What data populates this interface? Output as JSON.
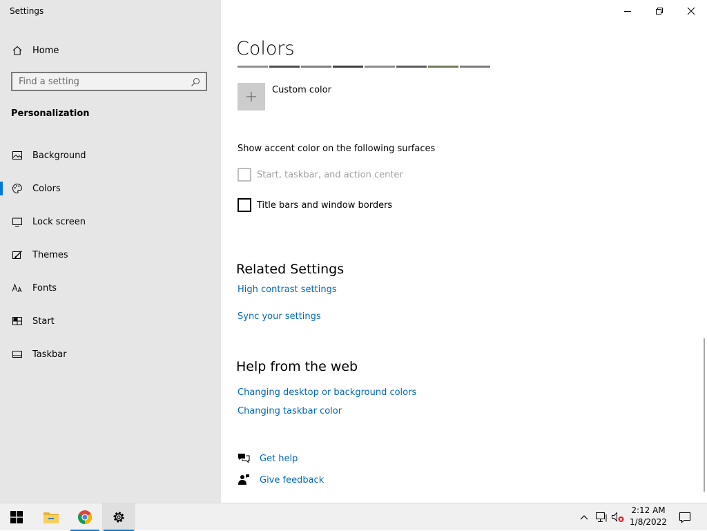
{
  "window": {
    "title": "Settings",
    "controls": {
      "minimize": "minimize",
      "restore": "restore",
      "close": "close"
    }
  },
  "sidebar": {
    "home_label": "Home",
    "search_placeholder": "Find a setting",
    "section_heading": "Personalization",
    "items": [
      {
        "label": "Background",
        "icon": "picture-icon"
      },
      {
        "label": "Colors",
        "icon": "palette-icon",
        "active": true
      },
      {
        "label": "Lock screen",
        "icon": "lock-screen-icon"
      },
      {
        "label": "Themes",
        "icon": "brush-icon"
      },
      {
        "label": "Fonts",
        "icon": "font-icon"
      },
      {
        "label": "Start",
        "icon": "start-icon"
      },
      {
        "label": "Taskbar",
        "icon": "taskbar-icon"
      }
    ]
  },
  "main": {
    "title": "Colors",
    "swatch_colors": [
      "#8f8f8f",
      "#4a4a4a",
      "#7e7e7e",
      "#3f3f3f",
      "#8a8c88",
      "#5a5a5a",
      "#6f7a58",
      "#7b7b7b"
    ],
    "custom_color_label": "Custom color",
    "surfaces_heading": "Show accent color on the following surfaces",
    "checkbox_start": "Start, taskbar, and action center",
    "checkbox_titlebars": "Title bars and window borders",
    "related_heading": "Related Settings",
    "related_links": {
      "high_contrast": "High contrast settings",
      "sync": "Sync your settings"
    },
    "help_heading": "Help from the web",
    "help_links": {
      "desktop_colors": "Changing desktop or background colors",
      "taskbar_color": "Changing taskbar color"
    },
    "get_help": "Get help",
    "give_feedback": "Give feedback"
  },
  "taskbar": {
    "clock_time": "2:12 AM",
    "clock_date": "1/8/2022"
  },
  "colors": {
    "accent": "#0078d7",
    "link": "#0066b4",
    "sidebar_bg": "#e6e6e6"
  }
}
